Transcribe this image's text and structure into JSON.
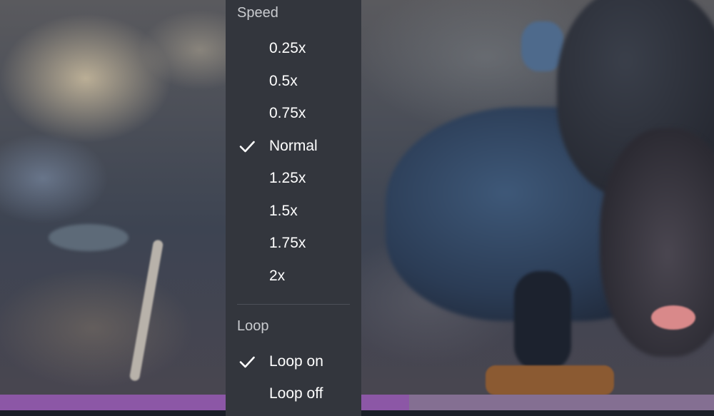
{
  "progress": {
    "played_fraction": 0.573
  },
  "menu": {
    "speed": {
      "header": "Speed",
      "items": [
        {
          "label": "0.25x",
          "selected": false
        },
        {
          "label": "0.5x",
          "selected": false
        },
        {
          "label": "0.75x",
          "selected": false
        },
        {
          "label": "Normal",
          "selected": true
        },
        {
          "label": "1.25x",
          "selected": false
        },
        {
          "label": "1.5x",
          "selected": false
        },
        {
          "label": "1.75x",
          "selected": false
        },
        {
          "label": "2x",
          "selected": false
        }
      ]
    },
    "loop": {
      "header": "Loop",
      "items": [
        {
          "label": "Loop on",
          "selected": true
        },
        {
          "label": "Loop off",
          "selected": false
        }
      ]
    }
  },
  "icons": {
    "selected": "check-icon"
  },
  "colors": {
    "menu_background": "#33363d",
    "progress_fill": "#8c57a6",
    "progress_track": "#846f92"
  }
}
